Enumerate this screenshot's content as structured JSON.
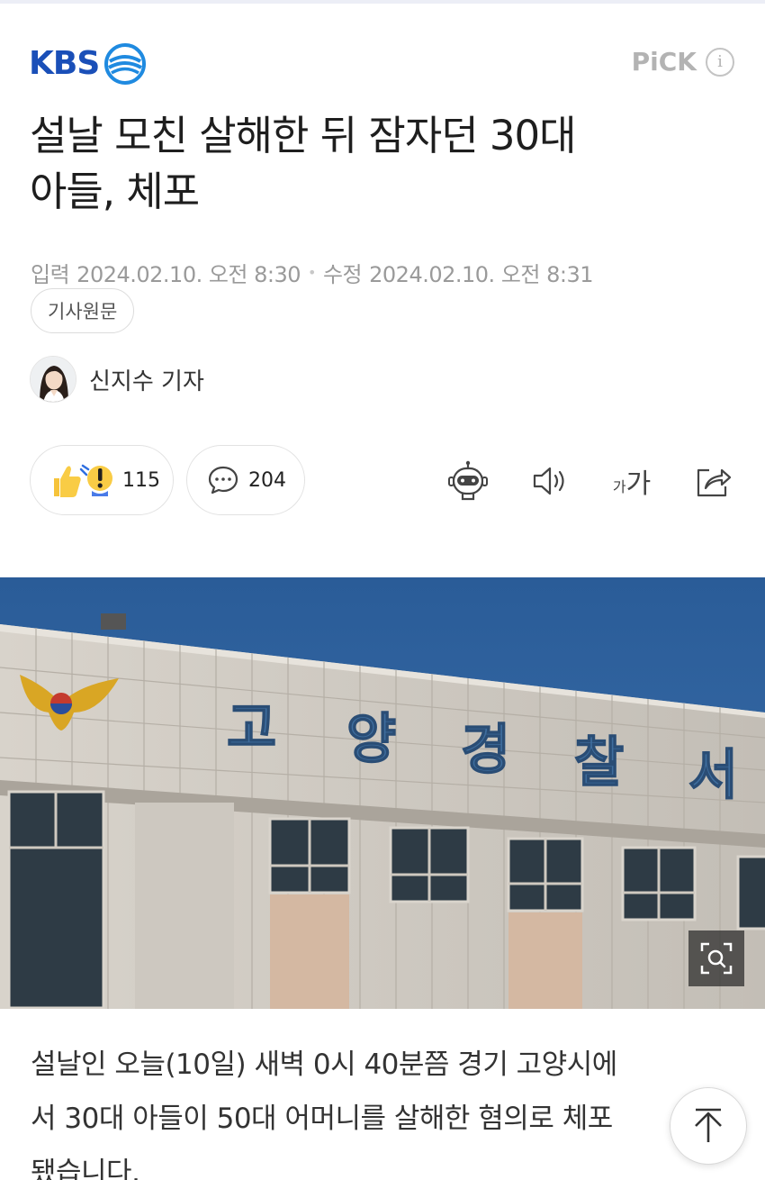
{
  "header": {
    "brand": "KBS",
    "pick_label": "PiCK",
    "info_label": "i"
  },
  "article": {
    "headline_line1": "설날 모친 살해한 뒤 잠자던 30대",
    "headline_line2": "아들, 체포",
    "published_label": "입력",
    "published_value": "2024.02.10. 오전 8:30",
    "modified_label": "수정",
    "modified_value": "2024.02.10. 오전 8:31",
    "original_button": "기사원문",
    "reporter": "신지수 기자",
    "body_line1": "설날인 오늘(10일) 새벽 0시 40분쯤 경기 고양시에",
    "body_line2": "서 30대 아들이 50대 어머니를 살해한 혐의로 체포",
    "body_line3": "됐습니다."
  },
  "actions": {
    "reaction_count": "115",
    "comment_count": "204",
    "font_small": "가",
    "font_big": "가"
  },
  "photo": {
    "sign_chars": [
      "고",
      "양",
      "경",
      "찰",
      "서"
    ]
  },
  "colors": {
    "brand_blue": "#1a4fb8",
    "sky": "#2c5a93",
    "building": "#c9c4bc"
  }
}
